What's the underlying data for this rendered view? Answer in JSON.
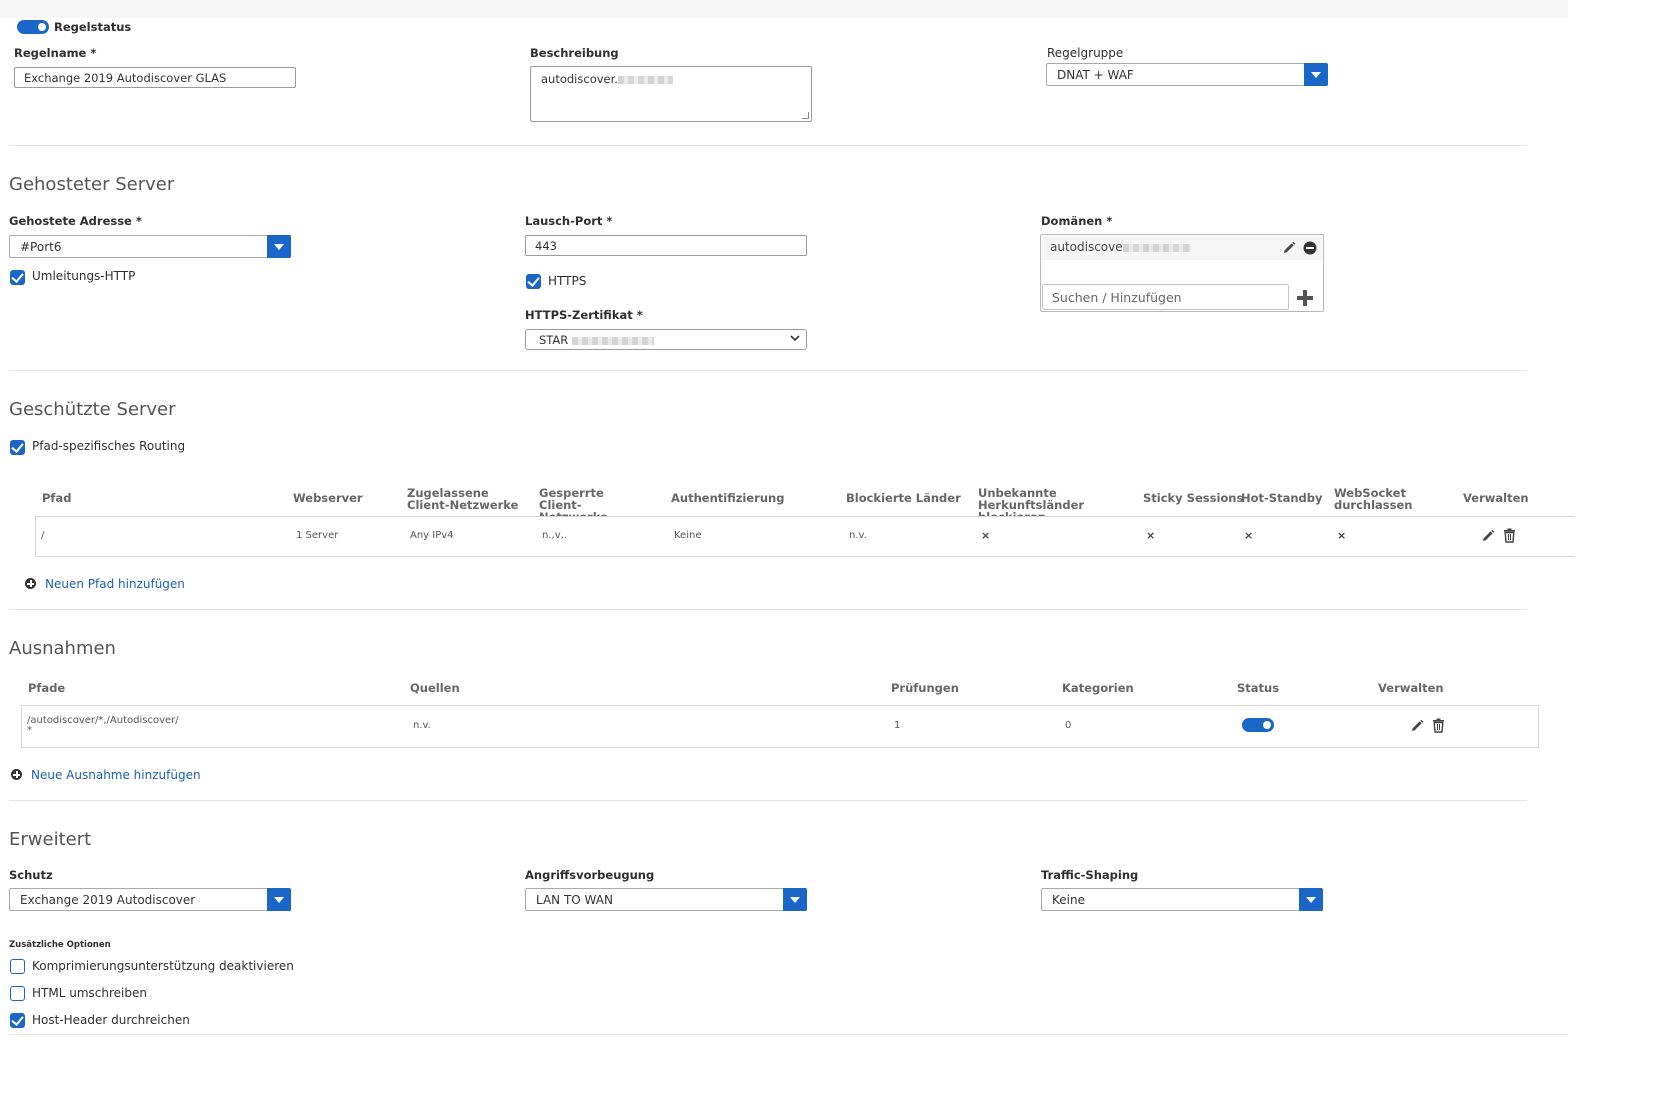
{
  "rule_status": {
    "label": "Regelstatus"
  },
  "rule_name": {
    "label": "Regelname *",
    "value": "Exchange 2019 Autodiscover GLAS"
  },
  "description": {
    "label": "Beschreibung",
    "value": "autodiscover."
  },
  "rule_group": {
    "label": "Regelgruppe",
    "value": "DNAT + WAF"
  },
  "hosted_server": {
    "title": "Gehosteter Server",
    "address_label": "Gehostete Adresse *",
    "address_value": "#Port6",
    "redirect_http_label": "Umleitungs-HTTP",
    "listen_port_label": "Lausch-Port *",
    "listen_port_value": "443",
    "https_label": "HTTPS",
    "cert_label": "HTTPS-Zertifikat *",
    "cert_value": "STAR",
    "domains_label": "Domänen *",
    "domain_value": "autodiscove",
    "search_placeholder": "Suchen / Hinzufügen"
  },
  "protected_servers": {
    "title": "Geschützte Server",
    "path_routing_label": "Pfad-spezifisches Routing",
    "columns": [
      "Pfad",
      "Webserver",
      "Zugelassene Client-Netzwerke",
      "Gesperrte Client-Netzwerke",
      "Authentifizierung",
      "Blockierte Länder",
      "Unbekannte Herkunftsländer blockieren",
      "Sticky Sessions",
      "Hot-Standby",
      "WebSocket durchlassen",
      "Verwalten"
    ],
    "row": {
      "path": "/",
      "webserver": "1 Server",
      "allowed": "Any IPv4",
      "blocked": "n.,v,.",
      "auth": "Keine",
      "countries": "n.v."
    },
    "add_path_label": "Neuen Pfad hinzufügen"
  },
  "exceptions": {
    "title": "Ausnahmen",
    "columns": [
      "Pfade",
      "Quellen",
      "Prüfungen",
      "Kategorien",
      "Status",
      "Verwalten"
    ],
    "row": {
      "path_line1": "/autodiscover/*,/Autodiscover/",
      "path_line2": "*",
      "sources": "n.v.",
      "checks": "1",
      "categories": "0"
    },
    "add_label": "Neue Ausnahme hinzufügen"
  },
  "advanced": {
    "title": "Erweitert",
    "protection_label": "Schutz",
    "protection_value": "Exchange 2019 Autodiscover",
    "ips_label": "Angriffsvorbeugung",
    "ips_value": "LAN TO WAN",
    "traffic_label": "Traffic-Shaping",
    "traffic_value": "Keine",
    "options_label": "Zusätzliche Optionen",
    "options": [
      {
        "label": "Komprimierungsunterstützung deaktivieren",
        "checked": false
      },
      {
        "label": "HTML umschreiben",
        "checked": false
      },
      {
        "label": "Host-Header durchreichen",
        "checked": true
      }
    ]
  },
  "colors": {
    "accent": "#1a67c9",
    "link": "#1a5fb4"
  }
}
